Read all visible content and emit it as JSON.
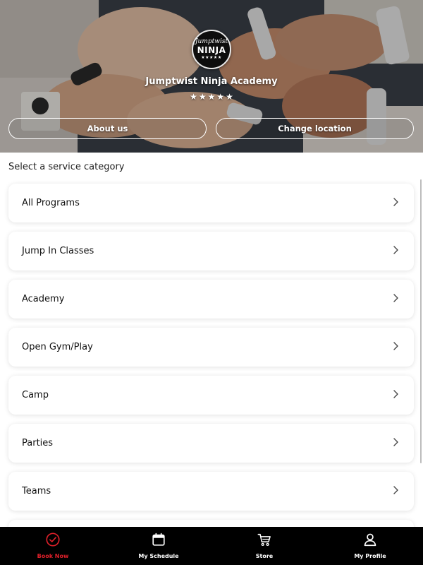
{
  "hero": {
    "logo": {
      "top_text": "Jumptwist",
      "main_text": "NINJA",
      "stars": "★★★★★"
    },
    "academy_name": "Jumptwist Ninja Academy",
    "rating": {
      "stars": 5,
      "max": 5,
      "star_glyph": "★"
    },
    "about_button": "About us",
    "location_button": "Change location"
  },
  "services": {
    "heading": "Select a service category",
    "categories": [
      {
        "label": "All Programs"
      },
      {
        "label": "Jump In Classes"
      },
      {
        "label": "Academy"
      },
      {
        "label": "Open Gym/Play"
      },
      {
        "label": "Camp"
      },
      {
        "label": "Parties"
      },
      {
        "label": "Teams"
      }
    ],
    "chevron_icon": "chevron-right-icon"
  },
  "bottom_nav": {
    "items": [
      {
        "label": "Book Now",
        "icon": "check-circle-icon",
        "active": true
      },
      {
        "label": "My Schedule",
        "icon": "calendar-icon",
        "active": false
      },
      {
        "label": "Store",
        "icon": "cart-icon",
        "active": false
      },
      {
        "label": "My Profile",
        "icon": "user-icon",
        "active": false
      }
    ]
  },
  "colors": {
    "accent": "#e0202a",
    "nav_background": "#000000",
    "card_background": "#ffffff",
    "text": "#111111"
  }
}
